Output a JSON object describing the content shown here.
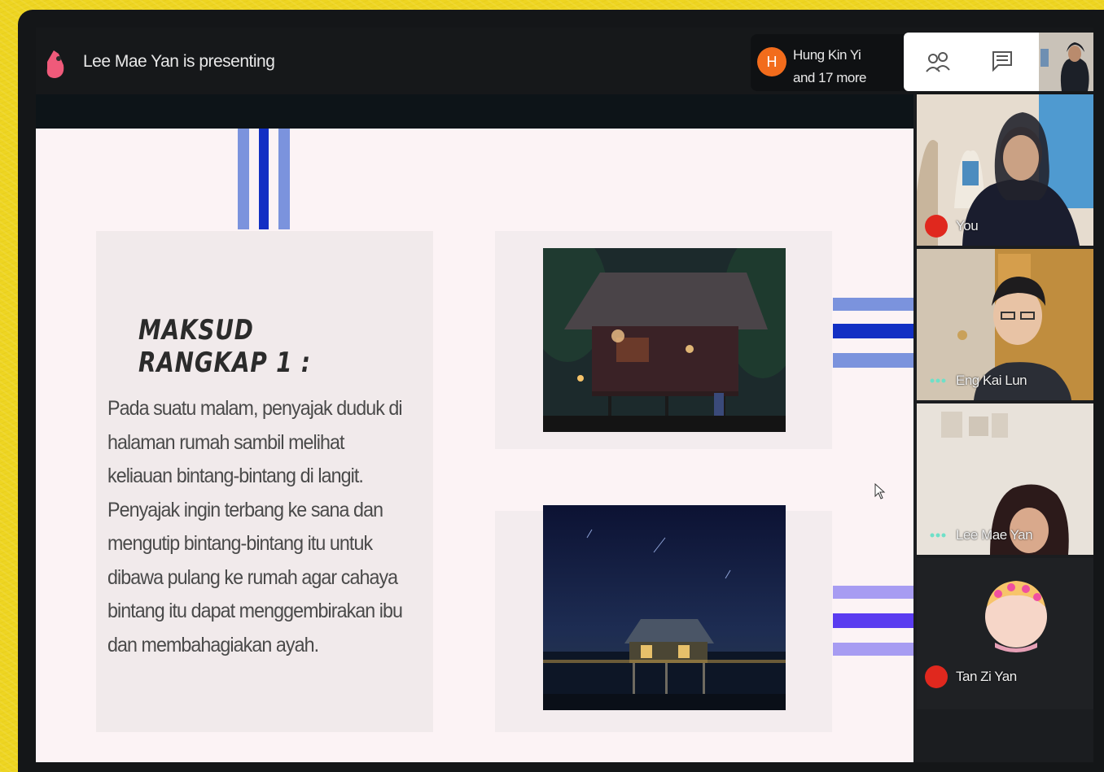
{
  "meeting": {
    "presenting_text": "Lee Mae Yan is presenting",
    "participants": {
      "avatar_letter": "H",
      "line1": "Hung Kin Yi",
      "line2": "and 17 more"
    },
    "self_label": "You"
  },
  "slide": {
    "heading": "MAKSUD RANGKAP 1 :",
    "body": "Pada suatu malam, penyajak duduk di halaman rumah sambil melihat keliauan bintang-bintang di langit. Penyajak ingin terbang ke sana dan mengutip bintang-bintang itu untuk dibawa pulang ke rumah agar cahaya bintang itu dapat menggembirakan ibu dan membahagiakan ayah.",
    "images": [
      "night-house-photo",
      "starry-stilt-house-photo"
    ]
  },
  "tiles": [
    {
      "name": "You",
      "mic": "muted"
    },
    {
      "name": "Eng Kai Lun",
      "mic": "speaking"
    },
    {
      "name": "Lee Mae Yan",
      "mic": "speaking"
    },
    {
      "name": "Tan Zi Yan",
      "mic": "muted"
    }
  ],
  "colors": {
    "stripe_light": "#7b93dd",
    "stripe_dark": "#1230c4",
    "stripe_violet_light": "#a79cf2",
    "stripe_violet_dark": "#5a3cf0",
    "accent_orange": "#f26c1c",
    "mic_red": "#e0281e"
  },
  "icons": [
    "presenter-icon",
    "people-icon",
    "chat-icon",
    "mic-off-icon",
    "speaking-icon",
    "cursor-icon"
  ]
}
